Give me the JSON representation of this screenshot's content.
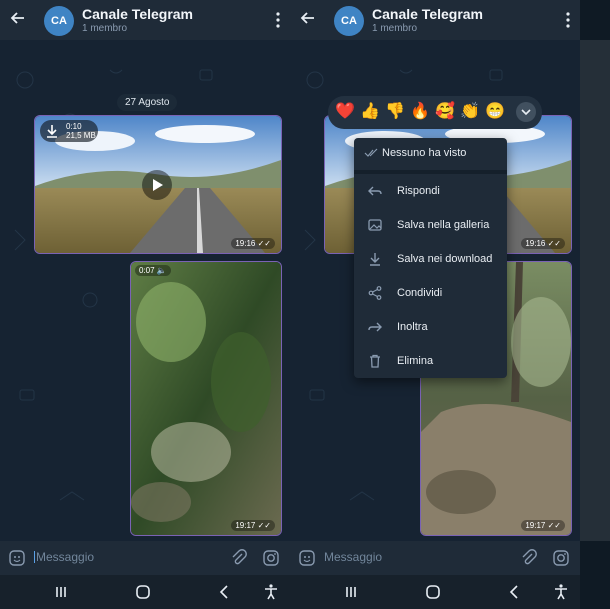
{
  "left": {
    "header": {
      "avatar_initials": "CA",
      "title": "Canale Telegram",
      "subtitle": "1 membro"
    },
    "date_pill": "27 Agosto",
    "video1": {
      "duration": "0:10",
      "size": "21,5 MB",
      "time": "19:16"
    },
    "video2": {
      "duration": "0:07",
      "time": "19:17"
    },
    "composer": {
      "placeholder": "Messaggio"
    }
  },
  "right": {
    "header": {
      "avatar_initials": "CA",
      "title": "Canale Telegram",
      "subtitle": "1 membro"
    },
    "video1": {
      "time": "19:16"
    },
    "video2": {
      "time": "19:17"
    },
    "reactions": [
      "❤️",
      "👍",
      "👎",
      "🔥",
      "🥰",
      "👏",
      "😁"
    ],
    "menu": {
      "seen": "Nessuno ha visto",
      "items": [
        "Rispondi",
        "Salva nella galleria",
        "Salva nei download",
        "Condividi",
        "Inoltra",
        "Elimina"
      ]
    },
    "composer": {
      "placeholder": "Messaggio"
    }
  },
  "icons": {
    "back": "arrow-left-icon",
    "more": "more-vertical-icon",
    "download": "download-icon",
    "play": "play-icon",
    "emoji": "emoji-icon",
    "attach": "paperclip-icon",
    "camera": "instagram-camera-icon",
    "nav_recents": "recents-icon",
    "nav_home": "home-icon",
    "nav_back": "back-chevron-icon",
    "nav_accessibility": "accessibility-icon"
  },
  "colors": {
    "accent": "#3f84c4",
    "bubble_border": "#7a62b5",
    "menu_bg": "#1f2b38",
    "header_bg": "#1f2b38",
    "chat_bg": "#162332"
  }
}
